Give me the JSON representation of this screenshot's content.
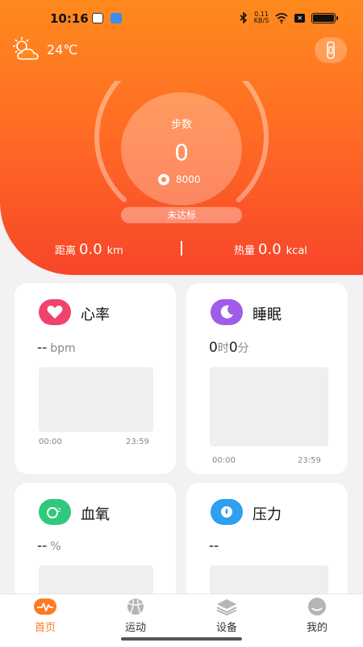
{
  "status_bar": {
    "time": "10:16",
    "network_speed": "0.11\nKB/S"
  },
  "weather": {
    "temperature": "24℃",
    "icon": "partly-cloudy-icon"
  },
  "steps": {
    "label": "步数",
    "value": "0",
    "goal": "8000",
    "status": "未达标",
    "progress_fraction": 0
  },
  "stats": {
    "distance_label": "距离",
    "distance_value": "0.0",
    "distance_unit": "km",
    "calorie_label": "热量",
    "calorie_value": "0.0",
    "calorie_unit": "kcal"
  },
  "cards": {
    "heart": {
      "title": "心率",
      "value": "--",
      "unit": "bpm",
      "start": "00:00",
      "end": "23:59",
      "color": "#f0436c"
    },
    "sleep": {
      "title": "睡眠",
      "hours": "0",
      "hours_unit": "时",
      "minutes": "0",
      "minutes_unit": "分",
      "start": "00:00",
      "end": "23:59",
      "color": "#a05ce8"
    },
    "oxygen": {
      "title": "血氧",
      "value": "--",
      "unit": "%",
      "color": "#2fc97c"
    },
    "pressure": {
      "title": "压力",
      "value": "--",
      "color": "#2f9ff0"
    }
  },
  "nav": [
    {
      "label": "首页",
      "icon": "pulse-icon",
      "active": true
    },
    {
      "label": "运动",
      "icon": "ball-icon",
      "active": false
    },
    {
      "label": "设备",
      "icon": "layers-icon",
      "active": false
    },
    {
      "label": "我的",
      "icon": "profile-icon",
      "active": false
    }
  ],
  "colors": {
    "accent": "#ff7a22",
    "hero_top": "#ff8a1e",
    "hero_bottom": "#f8452a"
  }
}
